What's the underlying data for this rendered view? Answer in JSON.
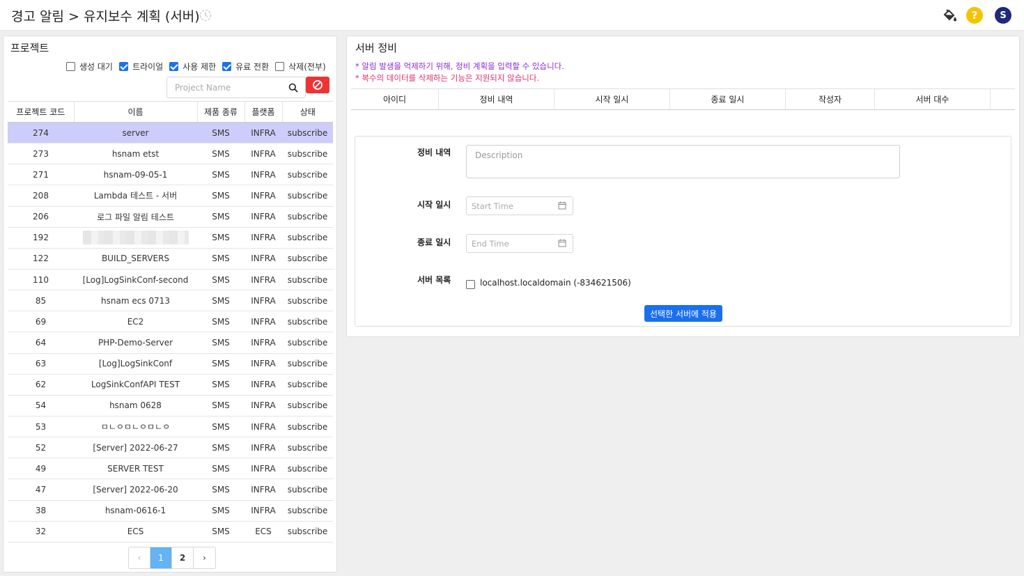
{
  "header": {
    "title": "경고 알림 > 유지보수 계획 (서버)",
    "icons": [
      "history-icon",
      "paint-bucket-icon",
      "help-icon",
      "avatar"
    ],
    "help_symbol": "?",
    "avatar_letter": "S",
    "help_color": "#f5c400",
    "avatar_color": "#1e2a78"
  },
  "projects": {
    "title": "프로젝트",
    "filters": [
      {
        "label": "생성 대기",
        "checked": false
      },
      {
        "label": "트라이얼",
        "checked": true
      },
      {
        "label": "사용 제한",
        "checked": true
      },
      {
        "label": "유료 전환",
        "checked": true
      },
      {
        "label": "삭제(전부)",
        "checked": false
      }
    ],
    "search_placeholder": "Project Name",
    "columns": [
      "프로젝트 코드",
      "이름",
      "제품 종류",
      "플랫폼",
      "상태"
    ],
    "rows": [
      {
        "code": "274",
        "name": "server",
        "product": "SMS",
        "platform": "INFRA",
        "status": "subscribe",
        "selected": true
      },
      {
        "code": "273",
        "name": "hsnam etst",
        "product": "SMS",
        "platform": "INFRA",
        "status": "subscribe"
      },
      {
        "code": "271",
        "name": "hsnam-09-05-1",
        "product": "SMS",
        "platform": "INFRA",
        "status": "subscribe"
      },
      {
        "code": "208",
        "name": "Lambda 테스트 - 서버",
        "product": "SMS",
        "platform": "INFRA",
        "status": "subscribe"
      },
      {
        "code": "206",
        "name": "로그 파일 알림 테스트",
        "product": "SMS",
        "platform": "INFRA",
        "status": "subscribe"
      },
      {
        "code": "192",
        "name": "",
        "product": "SMS",
        "platform": "INFRA",
        "status": "subscribe",
        "blurred": true
      },
      {
        "code": "122",
        "name": "BUILD_SERVERS",
        "product": "SMS",
        "platform": "INFRA",
        "status": "subscribe"
      },
      {
        "code": "110",
        "name": "[Log]LogSinkConf-second",
        "product": "SMS",
        "platform": "INFRA",
        "status": "subscribe"
      },
      {
        "code": "85",
        "name": "hsnam ecs 0713",
        "product": "SMS",
        "platform": "INFRA",
        "status": "subscribe"
      },
      {
        "code": "69",
        "name": "EC2",
        "product": "SMS",
        "platform": "INFRA",
        "status": "subscribe"
      },
      {
        "code": "64",
        "name": "PHP-Demo-Server",
        "product": "SMS",
        "platform": "INFRA",
        "status": "subscribe"
      },
      {
        "code": "63",
        "name": "[Log]LogSinkConf",
        "product": "SMS",
        "platform": "INFRA",
        "status": "subscribe"
      },
      {
        "code": "62",
        "name": "LogSinkConfAPI TEST",
        "product": "SMS",
        "platform": "INFRA",
        "status": "subscribe"
      },
      {
        "code": "54",
        "name": "hsnam 0628",
        "product": "SMS",
        "platform": "INFRA",
        "status": "subscribe"
      },
      {
        "code": "53",
        "name": "ㅁㄴㅇㅁㄴㅇㅁㄴㅇ",
        "product": "SMS",
        "platform": "INFRA",
        "status": "subscribe"
      },
      {
        "code": "52",
        "name": "[Server] 2022-06-27",
        "product": "SMS",
        "platform": "INFRA",
        "status": "subscribe"
      },
      {
        "code": "49",
        "name": "SERVER TEST",
        "product": "SMS",
        "platform": "INFRA",
        "status": "subscribe"
      },
      {
        "code": "47",
        "name": "[Server] 2022-06-20",
        "product": "SMS",
        "platform": "INFRA",
        "status": "subscribe"
      },
      {
        "code": "38",
        "name": "hsnam-0616-1",
        "product": "SMS",
        "platform": "INFRA",
        "status": "subscribe"
      },
      {
        "code": "32",
        "name": "ECS",
        "product": "SMS",
        "platform": "ECS",
        "status": "subscribe"
      }
    ],
    "pagination": {
      "prev": "‹",
      "pages": [
        "1",
        "2"
      ],
      "current": "1",
      "next": "›"
    }
  },
  "maintenance": {
    "title": "서버 정비",
    "notice1": "* 알림 발생을 억제하기 위해, 정비 계획을 입력할 수 있습니다.",
    "notice2": "* 복수의 데이터를 삭제하는 기능은 지원되지 않습니다.",
    "notice1_color": "#8a2be2",
    "notice2_color": "#e0306b",
    "columns": [
      "아이디",
      "정비 내역",
      "시작 일시",
      "종료 일시",
      "작성자",
      "서버 대수"
    ],
    "form": {
      "desc_label": "정비 내역",
      "desc_placeholder": "Description",
      "start_label": "시작 일시",
      "start_placeholder": "Start Time",
      "end_label": "종료 일시",
      "end_placeholder": "End Time",
      "server_label": "서버 목록",
      "server_option": "localhost.localdomain (-834621506)",
      "apply_button": "선택한 서버에 적용"
    }
  }
}
